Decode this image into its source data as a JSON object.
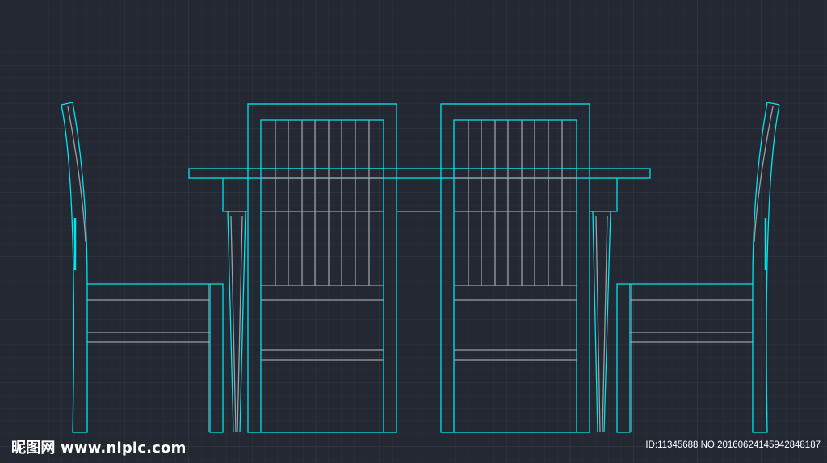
{
  "colors": {
    "background": "#232832",
    "grid_minor": "#2b3039",
    "grid_major": "#333944",
    "outline_cyan": "#00e5ee",
    "detail_gray": "#9aa0a6"
  },
  "watermark": {
    "site_text": "昵图网 www.nipic.com",
    "id_text": "ID:11345688 NO:20160624145942848187"
  }
}
